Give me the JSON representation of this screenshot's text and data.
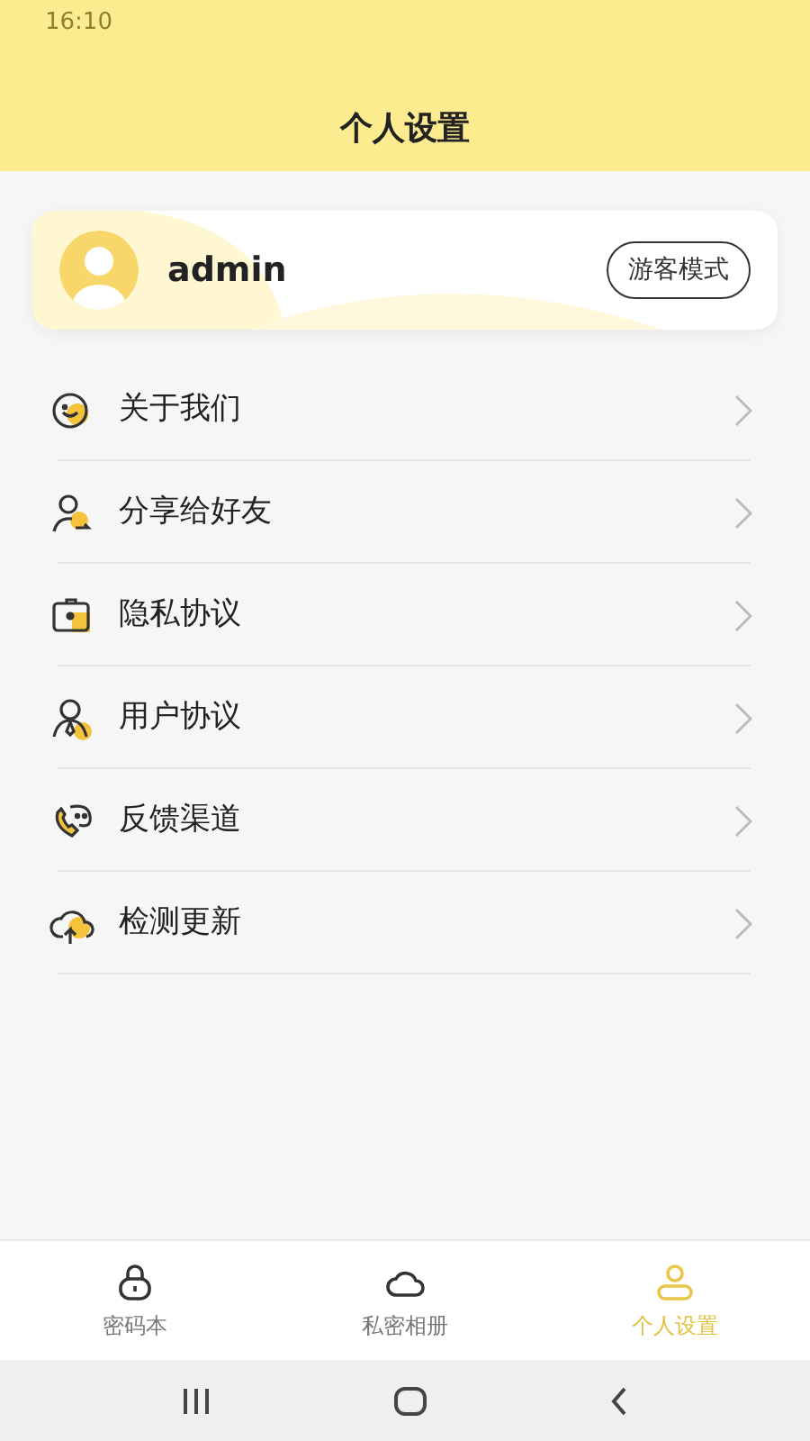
{
  "status_bar": {
    "time": "16:10"
  },
  "header": {
    "title": "个人设置"
  },
  "profile": {
    "username": "admin",
    "mode_button": "游客模式"
  },
  "menu": [
    {
      "kind": "about",
      "label": "关于我们"
    },
    {
      "kind": "share",
      "label": "分享给好友"
    },
    {
      "kind": "privacy",
      "label": "隐私协议"
    },
    {
      "kind": "user",
      "label": "用户协议"
    },
    {
      "kind": "feedback",
      "label": "反馈渠道"
    },
    {
      "kind": "update",
      "label": "检测更新"
    }
  ],
  "tabs": [
    {
      "kind": "lock",
      "label": "密码本",
      "selected": false
    },
    {
      "kind": "cloud",
      "label": "私密相册",
      "selected": false
    },
    {
      "kind": "person",
      "label": "个人设置",
      "selected": true
    }
  ]
}
